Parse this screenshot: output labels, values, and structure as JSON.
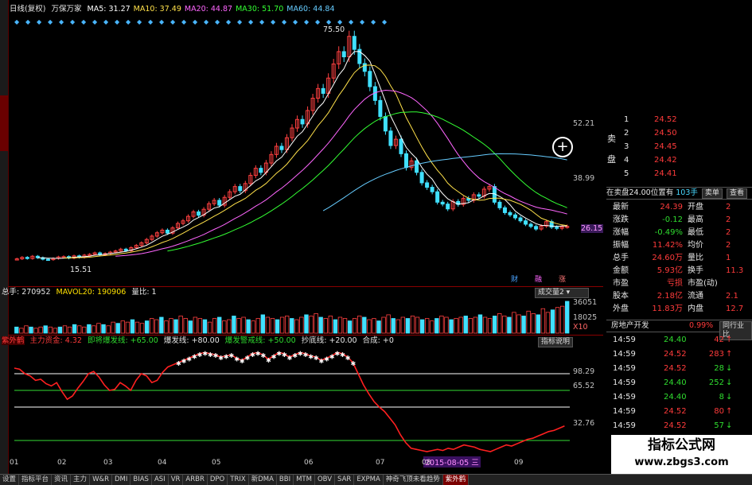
{
  "price_panel": {
    "period": "日线(复权)",
    "stock_name": "万保万家",
    "ma_labels": [
      {
        "label": "MA5: 31.27",
        "color": "#ffffff"
      },
      {
        "label": "MA10: 37.49",
        "color": "#ffe14a"
      },
      {
        "label": "MA20: 44.87",
        "color": "#ff66ff"
      },
      {
        "label": "MA30: 51.70",
        "color": "#33ff33"
      },
      {
        "label": "MA60: 44.84",
        "color": "#66ccff"
      }
    ],
    "y_labels": [
      "52.21",
      "38.99",
      "26.15"
    ],
    "high_mark": "75.50",
    "low_mark": "15.51",
    "badges": [
      {
        "text": "财",
        "color": "#4aa3ff"
      },
      {
        "text": "融",
        "color": "#ff66ff"
      },
      {
        "text": "涨",
        "color": "#ff7777"
      }
    ],
    "zoom_icon": "plus-circle-icon",
    "candles": [
      15.8,
      16.2,
      15.9,
      16.5,
      16.1,
      15.7,
      15.6,
      15.9,
      16.3,
      16.4,
      16.0,
      16.6,
      16.2,
      16.8,
      17.0,
      17.4,
      16.9,
      17.2,
      17.6,
      17.9,
      18.4,
      18.0,
      18.8,
      19.4,
      20.1,
      21.0,
      21.9,
      22.8,
      23.5,
      22.7,
      24.1,
      25.3,
      26.0,
      27.2,
      28.4,
      27.5,
      29.1,
      30.6,
      31.5,
      30.2,
      32.3,
      33.8,
      35.2,
      34.1,
      36.0,
      38.2,
      40.1,
      39.0,
      41.5,
      43.8,
      46.0,
      45.1,
      48.3,
      50.9,
      53.2,
      52.0,
      55.6,
      58.9,
      61.5,
      60.2,
      64.3,
      68.1,
      71.4,
      70.0,
      75.5,
      72.0,
      68.2,
      66.1,
      62.0,
      58.3,
      54.0,
      50.1,
      46.2,
      47.9,
      44.0,
      40.3,
      42.1,
      39.0,
      36.2,
      35.0,
      33.8,
      31.0,
      30.5,
      29.2,
      31.2,
      30.4,
      32.0,
      31.5,
      33.0,
      32.6,
      34.5,
      35.2,
      31.0,
      29.5,
      28.2,
      27.6,
      26.8,
      26.0,
      25.1,
      24.5,
      23.8,
      24.6,
      25.8,
      24.3,
      24.0,
      24.4,
      24.52
    ]
  },
  "volume_panel": {
    "total_label": "总手: 270952",
    "mavol_label": "MAVOL20: 190906",
    "vol_ratio_label": "量比: 1",
    "dropdown": "成交量2",
    "y_labels": [
      "36051",
      "18025",
      "X10"
    ],
    "bars": [
      5,
      4,
      6,
      5,
      4,
      5,
      6,
      5,
      4,
      5,
      6,
      5,
      7,
      6,
      5,
      7,
      6,
      8,
      7,
      6,
      9,
      8,
      10,
      9,
      11,
      9,
      8,
      10,
      12,
      11,
      13,
      10,
      12,
      11,
      14,
      12,
      10,
      13,
      12,
      11,
      9,
      12,
      13,
      10,
      11,
      14,
      12,
      13,
      11,
      10,
      12,
      15,
      13,
      12,
      11,
      13,
      14,
      12,
      11,
      13,
      15,
      14,
      16,
      13,
      12,
      14,
      11,
      13,
      12,
      10,
      12,
      14,
      13,
      11,
      12,
      10,
      13,
      15,
      12,
      11,
      13,
      12,
      14,
      13,
      11,
      12,
      10,
      12,
      14,
      13,
      11,
      12,
      13,
      14,
      12,
      13,
      15,
      13,
      12,
      14,
      16,
      14,
      13,
      17,
      15,
      14,
      18,
      16,
      15,
      20,
      17,
      19,
      21,
      22,
      26
    ]
  },
  "indicator_panel": {
    "name": "紫外鹤",
    "main_fund": "主力资金: 4.32",
    "line1": "即将爆发线: +65.00",
    "line2": "爆发线: +80.00",
    "line3": "爆发警戒线: +50.00",
    "line4": "抄底线: +20.00",
    "line5": "合成: +0",
    "help": "指标说明",
    "y_labels": [
      "98.29",
      "65.52",
      "32.76"
    ],
    "date_badge": "2015-08-05 三",
    "values": [
      85,
      84,
      80,
      78,
      74,
      75,
      71,
      69,
      72,
      64,
      57,
      60,
      67,
      73,
      80,
      82,
      77,
      70,
      65,
      66,
      72,
      69,
      65,
      74,
      80,
      78,
      72,
      74,
      81,
      86,
      88,
      90,
      92,
      94,
      96,
      98,
      99,
      98,
      97,
      95,
      96,
      97,
      94,
      92,
      95,
      98,
      99,
      97,
      93,
      96,
      99,
      98,
      95,
      97,
      99,
      98,
      96,
      95,
      92,
      94,
      96,
      99,
      98,
      95,
      90,
      80,
      70,
      62,
      55,
      50,
      46,
      40,
      34,
      25,
      18,
      13,
      12,
      11,
      10,
      11,
      12,
      11,
      13,
      12,
      14,
      16,
      15,
      14,
      12,
      11,
      10,
      12,
      14,
      16,
      15,
      17,
      19,
      21,
      22,
      24,
      26,
      28,
      29,
      31,
      33
    ],
    "x_ticks": [
      "01",
      "02",
      "03",
      "04",
      "05",
      "06",
      "07",
      "08",
      "09"
    ]
  },
  "right_panel": {
    "sell_label": "卖盘",
    "sell_levels": [
      {
        "n": "1",
        "p": "24.52"
      },
      {
        "n": "2",
        "p": "24.50"
      },
      {
        "n": "3",
        "p": "24.45"
      },
      {
        "n": "4",
        "p": "24.42"
      },
      {
        "n": "5",
        "p": "24.41"
      }
    ],
    "position_line": "在卖盘24.00位置有",
    "position_vol": "103手",
    "sell_btn": "卖单",
    "view_btn": "查看",
    "stats": [
      {
        "k": "最新",
        "v": "24.39",
        "k2": "开盘",
        "v2": "2"
      },
      {
        "k": "涨跌",
        "v": "-0.12",
        "k2": "最高",
        "v2": "2"
      },
      {
        "k": "涨幅",
        "v": "-0.49%",
        "k2": "最低",
        "v2": "2"
      },
      {
        "k": "振幅",
        "v": "11.42%",
        "k2": "均价",
        "v2": "2"
      },
      {
        "k": "总手",
        "v": "24.60万",
        "k2": "量比",
        "v2": "1"
      },
      {
        "k": "金额",
        "v": "5.93亿",
        "k2": "换手",
        "v2": "11.3"
      },
      {
        "k": "市盈",
        "v": "亏损",
        "k2": "市盈(动)",
        "v2": ""
      },
      {
        "k": "股本",
        "v": "2.18亿",
        "k2": "流通",
        "v2": "2.1"
      },
      {
        "k": "外盘",
        "v": "11.83万",
        "k2": "内盘",
        "v2": "12.7"
      }
    ],
    "sector": "房地产开发",
    "sector_pct": "0.99%",
    "sector_btn": "同行业比",
    "ticks": [
      {
        "t": "14:59",
        "p": "24.40",
        "v": "42",
        "c": "red"
      },
      {
        "t": "14:59",
        "p": "24.52",
        "v": "283",
        "c": "red"
      },
      {
        "t": "14:59",
        "p": "24.52",
        "v": "28",
        "c": "green"
      },
      {
        "t": "14:59",
        "p": "24.40",
        "v": "252",
        "c": "green"
      },
      {
        "t": "14:59",
        "p": "24.40",
        "v": "8",
        "c": "green"
      },
      {
        "t": "14:59",
        "p": "24.52",
        "v": "80",
        "c": "red"
      },
      {
        "t": "14:59",
        "p": "24.52",
        "v": "57",
        "c": "green"
      }
    ]
  },
  "watermark": {
    "line1": "指标公式网",
    "line2": "www.zbgs3.com"
  },
  "bottom_tabs": [
    "设置",
    "指标平台",
    "资讯",
    "主力",
    "W&R",
    "DMI",
    "BIAS",
    "ASI",
    "VR",
    "ARBR",
    "DPO",
    "TRIX",
    "新DMA",
    "BBI",
    "MTM",
    "OBV",
    "SAR",
    "EXPMA",
    "神奇飞顶未看趋势",
    "紫外鹤"
  ]
}
